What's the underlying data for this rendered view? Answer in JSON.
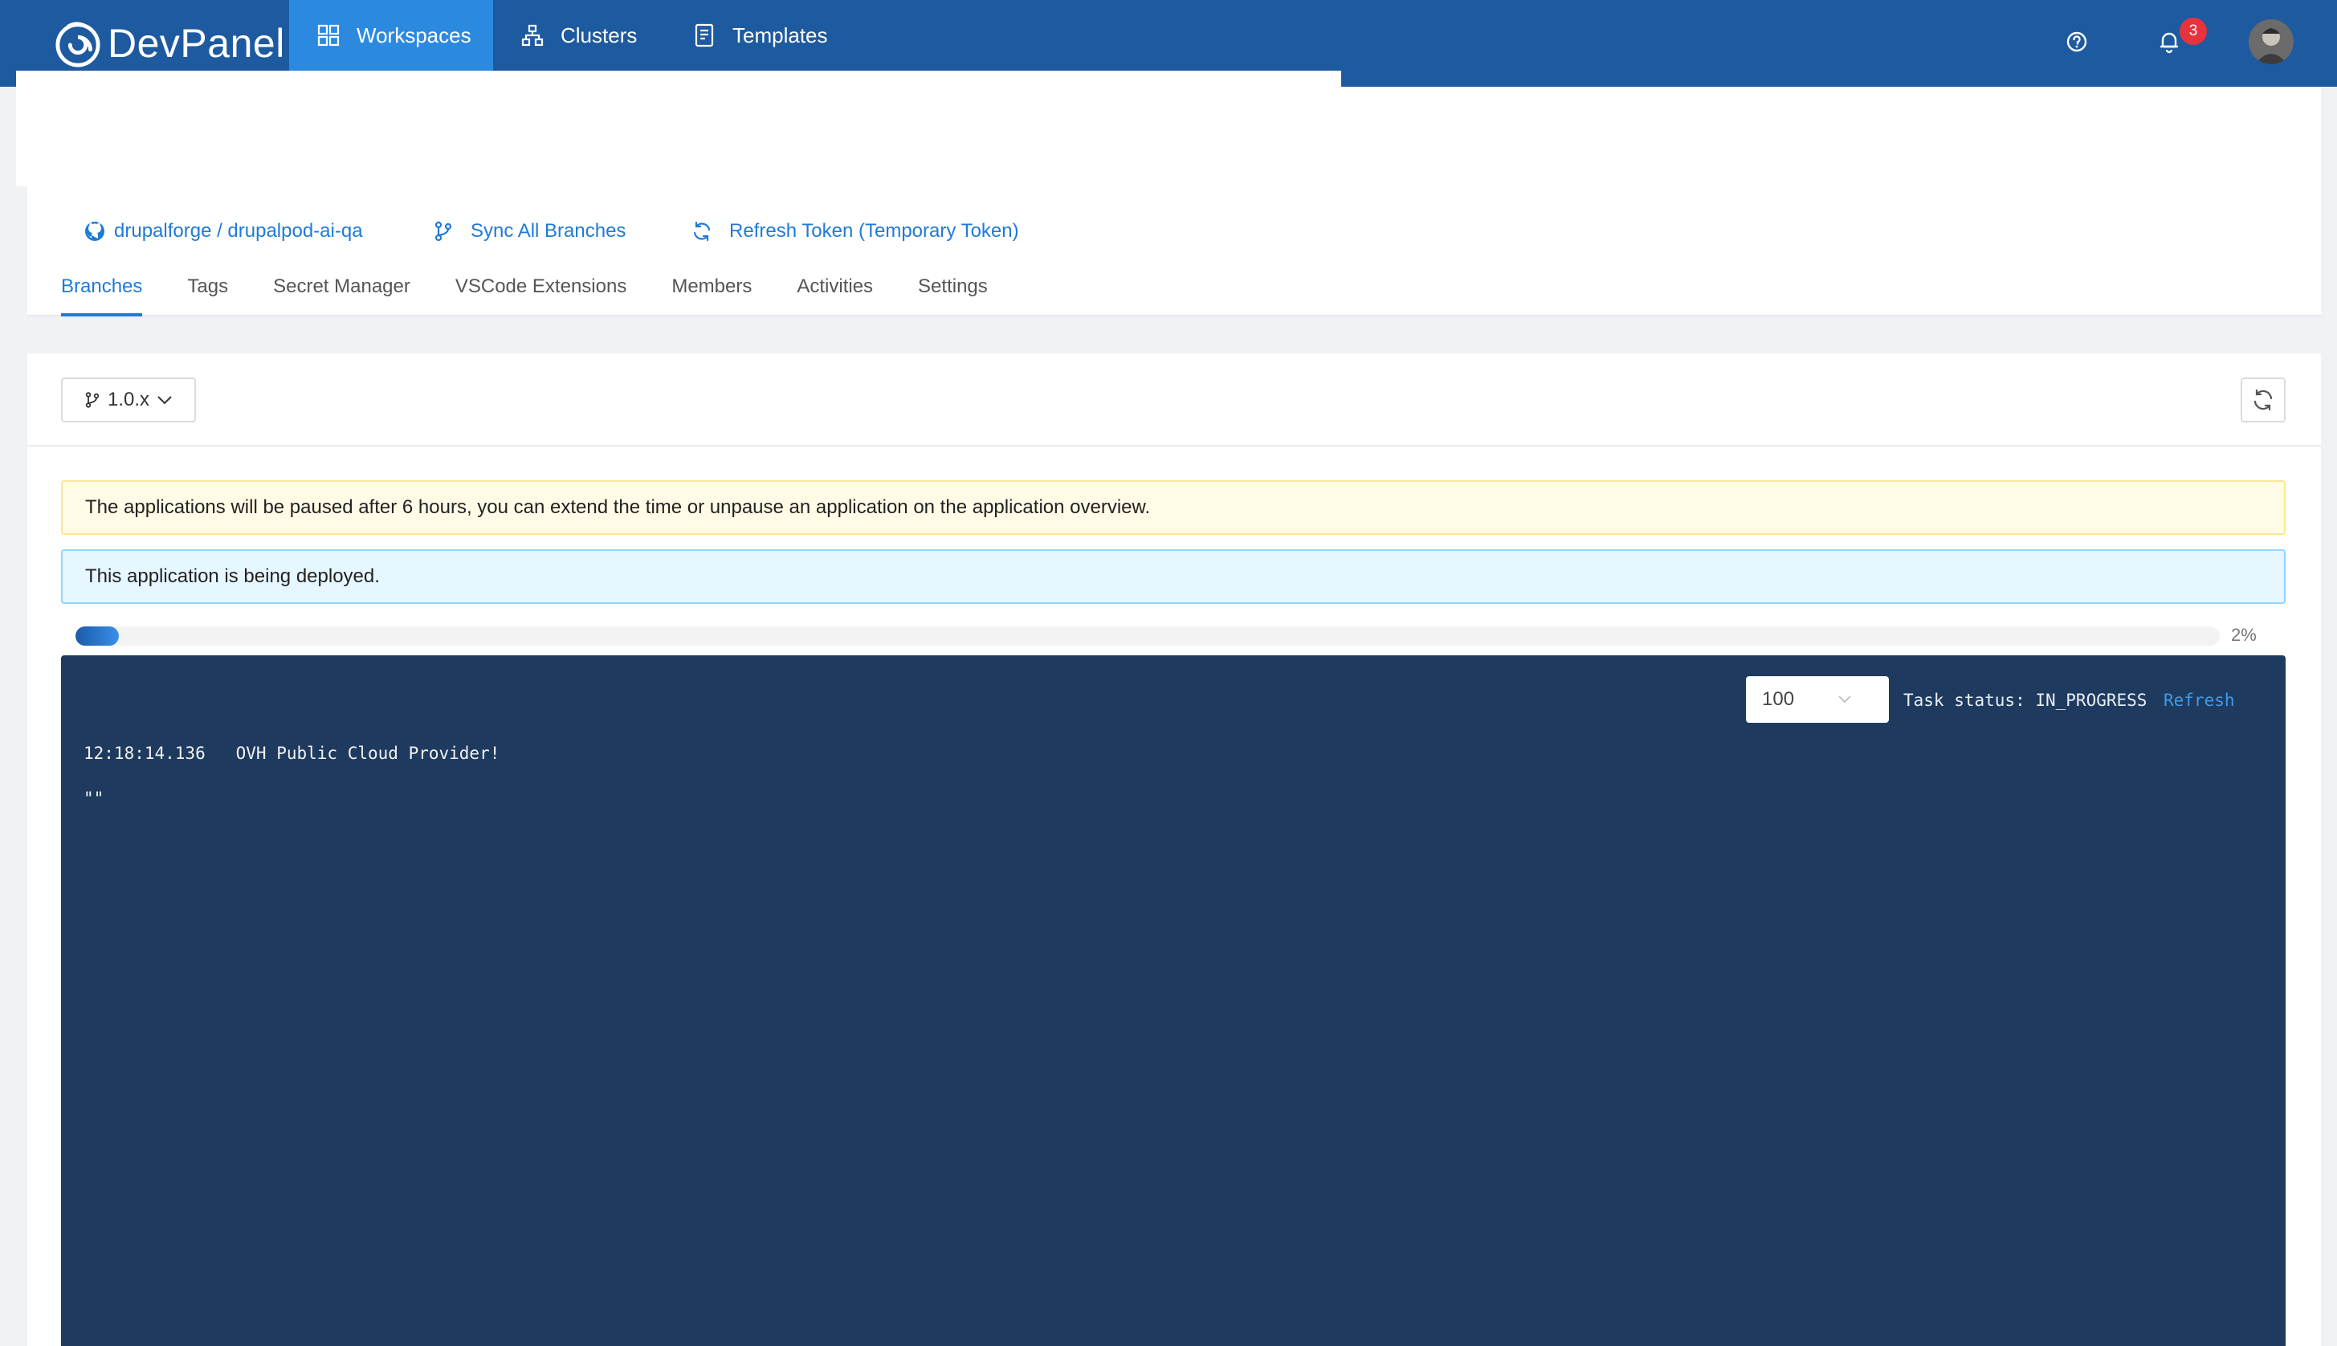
{
  "app": {
    "brand": "DevPanel",
    "nav": [
      {
        "label": "Workspaces",
        "icon": "grid-icon",
        "active": true
      },
      {
        "label": "Clusters",
        "icon": "sitemap-icon",
        "active": false
      },
      {
        "label": "Templates",
        "icon": "document-icon",
        "active": false
      }
    ],
    "notification_count": "3"
  },
  "project": {
    "repo_link": "drupalforge / drupalpod-ai-qa",
    "sync_link": "Sync All Branches",
    "refresh_token_link": "Refresh Token",
    "refresh_token_note": "(Temporary Token)",
    "tabs": [
      {
        "label": "Branches",
        "active": true
      },
      {
        "label": "Tags",
        "active": false
      },
      {
        "label": "Secret Manager",
        "active": false
      },
      {
        "label": "VSCode Extensions",
        "active": false
      },
      {
        "label": "Members",
        "active": false
      },
      {
        "label": "Activities",
        "active": false
      },
      {
        "label": "Settings",
        "active": false
      }
    ]
  },
  "branch": {
    "selected": "1.0.x"
  },
  "alerts": {
    "warning": "The applications will be paused after 6 hours, you can extend the time or unpause an application on the application overview.",
    "info": "This application is being deployed."
  },
  "progress": {
    "value": 0.02,
    "label": "2%"
  },
  "terminal": {
    "lines_option": "100",
    "task_status": "Task status: IN_PROGRESS",
    "refresh_label": "Refresh",
    "log": [
      "12:18:14.136   OVH Public Cloud Provider!",
      "\"\""
    ]
  },
  "colors": {
    "topbar": "#1e5aa0",
    "nav_active": "#2b8ae0",
    "link": "#1f7ad9",
    "terminal_bg": "#1f3a5f",
    "badge": "#e8323c"
  }
}
